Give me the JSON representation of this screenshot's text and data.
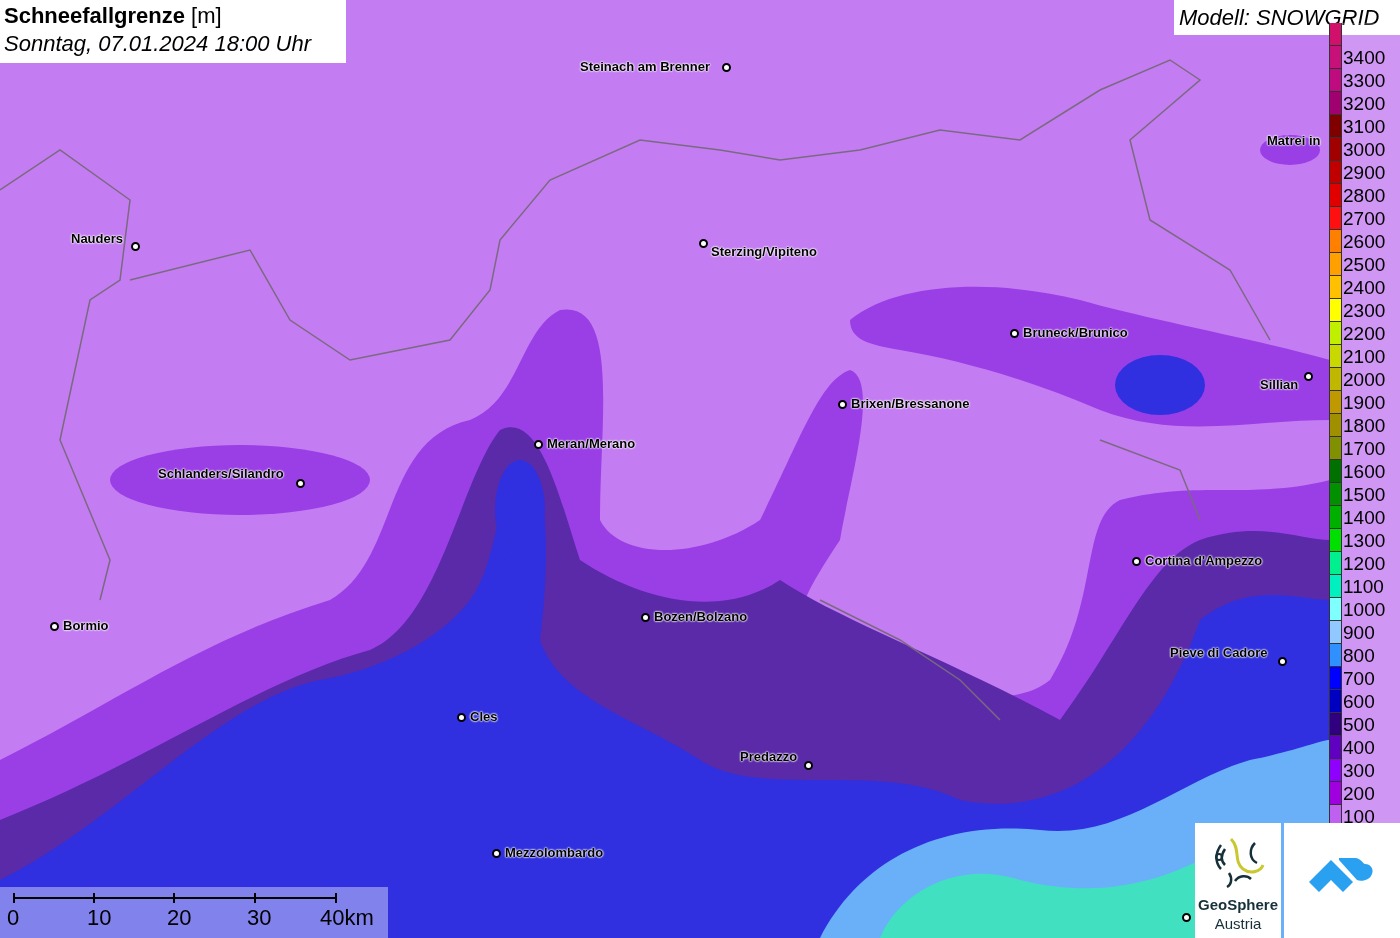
{
  "title": {
    "heading": "Schneefallgrenze",
    "unit": "[m]",
    "datetime": "Sonntag, 07.01.2024 18:00 Uhr"
  },
  "model": "Modell: SNOWGRID",
  "cities": [
    {
      "name": "Steinach am Brenner"
    },
    {
      "name": "Nauders"
    },
    {
      "name": "Sterzing/Vipiteno"
    },
    {
      "name": "Matrei in"
    },
    {
      "name": "Bruneck/Brunico"
    },
    {
      "name": "Sillian"
    },
    {
      "name": "Brixen/Bressanone"
    },
    {
      "name": "Meran/Merano"
    },
    {
      "name": "Schlanders/Silandro"
    },
    {
      "name": "Cortina d'Ampezzo"
    },
    {
      "name": "Bozen/Bolzano"
    },
    {
      "name": "Bormio"
    },
    {
      "name": "Pieve di Cadore"
    },
    {
      "name": "Cles"
    },
    {
      "name": "Predazzo"
    },
    {
      "name": "Mezzolombardo"
    }
  ],
  "legend": [
    {
      "color": "#d0106a"
    },
    {
      "label": "3400",
      "color": "#c8107a"
    },
    {
      "label": "3300",
      "color": "#c00a80"
    },
    {
      "label": "3200",
      "color": "#a00070"
    },
    {
      "label": "3100",
      "color": "#800000"
    },
    {
      "label": "3000",
      "color": "#a00000"
    },
    {
      "label": "2900",
      "color": "#c00000"
    },
    {
      "label": "2800",
      "color": "#e00000"
    },
    {
      "label": "2700",
      "color": "#ff1010"
    },
    {
      "label": "2600",
      "color": "#ff8000"
    },
    {
      "label": "2500",
      "color": "#ffa000"
    },
    {
      "label": "2400",
      "color": "#ffc000"
    },
    {
      "label": "2300",
      "color": "#ffff00"
    },
    {
      "label": "2200",
      "color": "#c0f000"
    },
    {
      "label": "2100",
      "color": "#c8d800"
    },
    {
      "label": "2000",
      "color": "#c0b800"
    },
    {
      "label": "1900",
      "color": "#c09800"
    },
    {
      "label": "1800",
      "color": "#a09000"
    },
    {
      "label": "1700",
      "color": "#809000"
    },
    {
      "label": "1600",
      "color": "#007000"
    },
    {
      "label": "1500",
      "color": "#009000"
    },
    {
      "label": "1400",
      "color": "#00b000"
    },
    {
      "label": "1300",
      "color": "#00e000"
    },
    {
      "label": "1200",
      "color": "#00f090"
    },
    {
      "label": "1100",
      "color": "#00f0c0"
    },
    {
      "label": "1000",
      "color": "#80ffff"
    },
    {
      "label": "900",
      "color": "#90c8ff"
    },
    {
      "label": "800",
      "color": "#3090ff"
    },
    {
      "label": "700",
      "color": "#0000ff"
    },
    {
      "label": "600",
      "color": "#0000c0"
    },
    {
      "label": "500",
      "color": "#300080"
    },
    {
      "label": "400",
      "color": "#6000c0"
    },
    {
      "label": "300",
      "color": "#9000ff"
    },
    {
      "label": "200",
      "color": "#a000e0"
    },
    {
      "label": "100",
      "color": "#c060f0"
    }
  ],
  "scale": [
    "0",
    "10",
    "20",
    "30",
    "40km"
  ],
  "logo": {
    "line1": "GeoSphere",
    "line2": "Austria"
  }
}
